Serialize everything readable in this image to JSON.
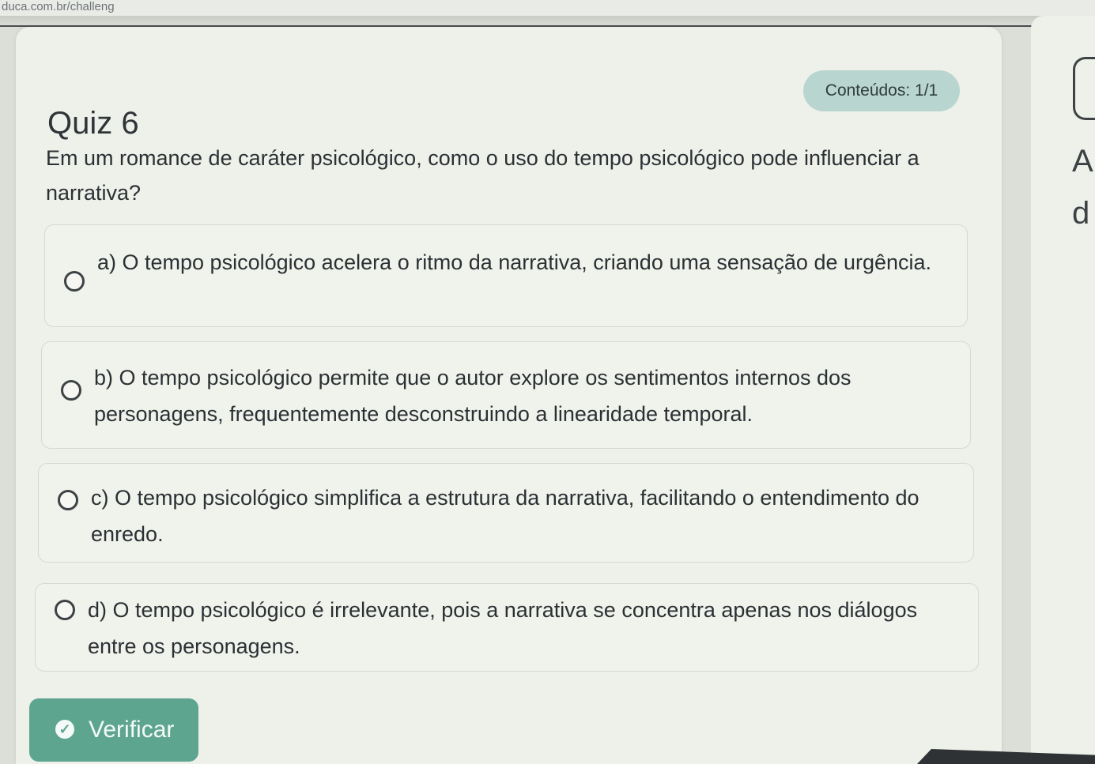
{
  "browser": {
    "url_fragment": "duca.com.br/challeng"
  },
  "header": {
    "badge": "Conteúdos: 1/1",
    "title": "Quiz 6"
  },
  "question": {
    "text": "Em um romance de caráter psicológico, como o uso do tempo psicológico pode influenciar a narrativa?"
  },
  "options": [
    {
      "text": "a) O tempo psicológico acelera o ritmo da narrativa, criando uma sensação de urgência."
    },
    {
      "text": "b) O tempo psicológico permite que o autor explore os sentimentos internos dos personagens, frequentemente desconstruindo a linearidade temporal."
    },
    {
      "text": "c) O tempo psicológico simplifica a estrutura da narrativa, facilitando o entendimento do enredo."
    },
    {
      "text": "d) O tempo psicológico é irrelevante, pois a narrativa se concentra apenas nos diálogos entre os personagens."
    }
  ],
  "actions": {
    "verify_label": "Verificar"
  },
  "side_panel": {
    "letter_1": "A",
    "letter_2": "d"
  },
  "colors": {
    "accent": "#5ea58f",
    "badge_bg": "#b9d5cf",
    "card_bg": "#eef0ea"
  }
}
